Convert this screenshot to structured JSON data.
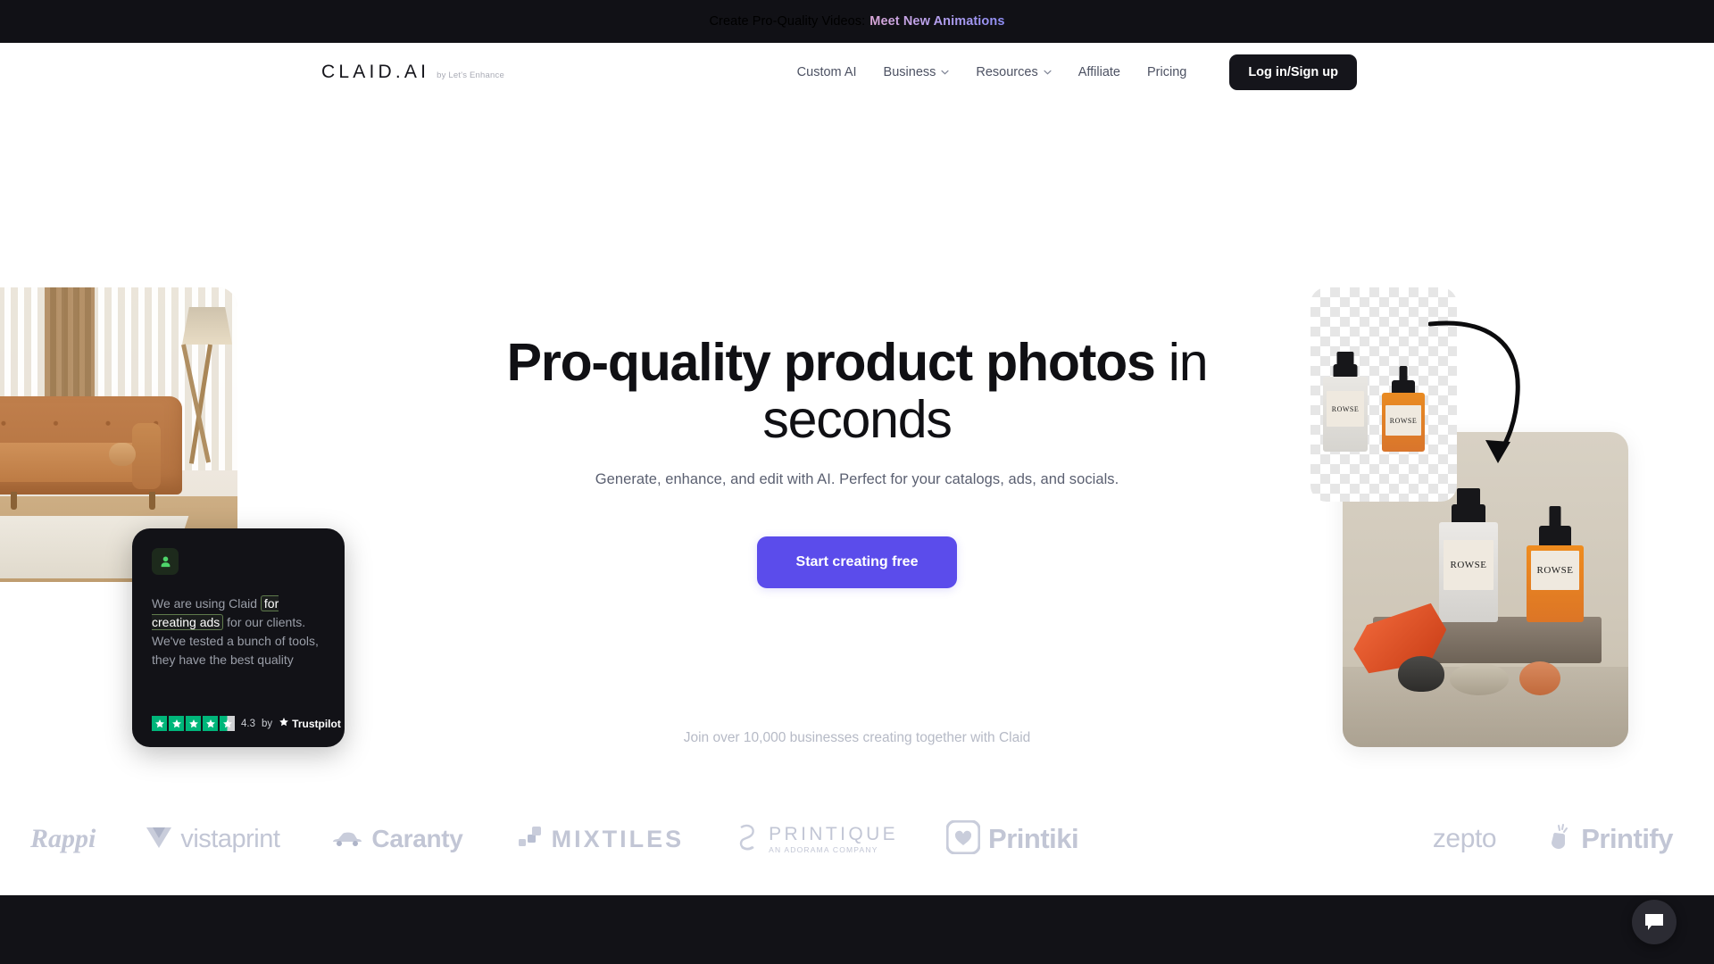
{
  "banner": {
    "text": "Create Pro-Quality Videos:",
    "link_label": "Meet New Animations",
    "background": "#111116",
    "link_color": "#b7a0e8"
  },
  "header": {
    "logo": "CLAID.AI",
    "logo_subtitle": "by Let's Enhance",
    "nav": [
      {
        "label": "Custom AI",
        "has_chevron": false
      },
      {
        "label": "Business",
        "has_chevron": true
      },
      {
        "label": "Resources",
        "has_chevron": true
      },
      {
        "label": "Affiliate",
        "has_chevron": false
      },
      {
        "label": "Pricing",
        "has_chevron": false
      }
    ],
    "login_label": "Log in/Sign up"
  },
  "hero": {
    "headline_bold": "Pro-quality product photos",
    "headline_light": " in seconds",
    "subheadline": "Generate, enhance, and edit with AI. Perfect for your catalogs, ads, and socials.",
    "cta_label": "Start creating free",
    "cta_color": "#5b4ceb"
  },
  "testimonial": {
    "avatar_icon": "person-icon",
    "quote_before": "We are using Claid ",
    "quote_highlight": "for creating ads",
    "quote_after": " for our clients. We've tested a bunch of tools, they have the best quality",
    "rating": "4.3",
    "by_label": "by",
    "brand": "Trustpilot",
    "stars_filled": 4,
    "stars_total": 5,
    "star_color": "#00b67a"
  },
  "hero_images": {
    "transparent_card_label": "ROWSE",
    "styled_photo_label": "ROWSE",
    "left_image_name": "living-room-sofa-photo",
    "arrow_name": "curved-arrow"
  },
  "social_proof": {
    "trust_text": "Join over 10,000 businesses creating together with Claid",
    "logos": [
      {
        "name": "Rappi"
      },
      {
        "name": "vistaprint"
      },
      {
        "name": "Caranty"
      },
      {
        "name": "MIXTILES"
      },
      {
        "name": "PRINTIQUE",
        "subtitle": "AN ADORAMA COMPANY"
      },
      {
        "name": "Printiki"
      },
      {
        "name": "zepto"
      },
      {
        "name": "Printify"
      }
    ]
  },
  "chat": {
    "icon": "chat-bubble-icon"
  }
}
